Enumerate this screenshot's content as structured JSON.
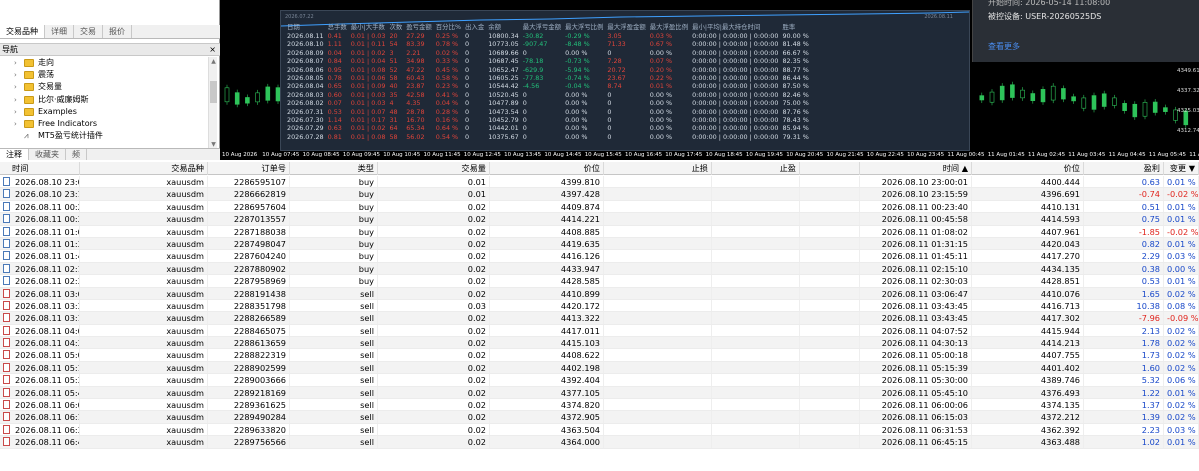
{
  "nav": {
    "tabs": [
      "交易品种",
      "详细",
      "交易",
      "报价"
    ],
    "active_tab": "交易品种",
    "title": "导航",
    "close_glyph": "×",
    "tree": [
      {
        "label": "走向",
        "type": "folder"
      },
      {
        "label": "震荡",
        "type": "folder"
      },
      {
        "label": "交易量",
        "type": "folder"
      },
      {
        "label": "比尔·威廉姆斯",
        "type": "folder"
      },
      {
        "label": "Examples",
        "type": "folder"
      },
      {
        "label": "Free Indicators",
        "type": "folder"
      },
      {
        "label": "MT5盈亏统计插件",
        "type": "script"
      }
    ],
    "bottom_tabs": [
      "注释",
      "收藏夹",
      "频"
    ]
  },
  "popup": {
    "line1": "开始时间: 2026-05-14 11:08:00",
    "line2_label": "被控设备:",
    "line2_value": "USER-20260525DS",
    "link": "查看更多"
  },
  "stats": {
    "mini_date_left": "2026.07.22",
    "mini_date_right": "2026.08.11",
    "headers": [
      "日期",
      "总手数",
      "最小|大手数",
      "次数",
      "盈亏金额",
      "百分比%",
      "出入金",
      "余额",
      "最大浮亏金额",
      "最大浮亏比例",
      "最大浮盈金额",
      "最大浮盈比例",
      "最小|平均|最大持仓时间",
      "胜率"
    ],
    "rows": [
      [
        "2026.08.11",
        "0.41",
        "0.01 | 0.03",
        "20",
        "27.29",
        "0.25 %",
        "0",
        "10800.34",
        "-30.82",
        "-0.29 %",
        "3.05",
        "0.03 %",
        "0:00:00 | 0:00:00 | 0:00:00",
        "90.00 %"
      ],
      [
        "2026.08.10",
        "1.11",
        "0.01 | 0.11",
        "54",
        "83.39",
        "0.78 %",
        "0",
        "10773.05",
        "-907.47",
        "-8.48 %",
        "71.33",
        "0.67 %",
        "0:00:00 | 0:00:00 | 0:00:00",
        "81.48 %"
      ],
      [
        "2026.08.09",
        "0.04",
        "0.01 | 0.02",
        "3",
        "2.21",
        "0.02 %",
        "0",
        "10689.66",
        "0",
        "0.00 %",
        "0",
        "0.00 %",
        "0:00:00 | 0:00:00 | 0:00:00",
        "66.67 %"
      ],
      [
        "2026.08.07",
        "0.84",
        "0.01 | 0.04",
        "51",
        "34.98",
        "0.33 %",
        "0",
        "10687.45",
        "-78.18",
        "-0.73 %",
        "7.28",
        "0.07 %",
        "0:00:00 | 0:00:00 | 0:00:00",
        "82.35 %"
      ],
      [
        "2026.08.06",
        "0.95",
        "0.01 | 0.08",
        "52",
        "47.22",
        "0.45 %",
        "0",
        "10652.47",
        "-629.9",
        "-5.94 %",
        "20.72",
        "0.20 %",
        "0:00:00 | 0:00:00 | 0:00:00",
        "88.77 %"
      ],
      [
        "2026.08.05",
        "0.78",
        "0.01 | 0.06",
        "58",
        "60.43",
        "0.58 %",
        "0",
        "10605.25",
        "-77.83",
        "-0.74 %",
        "23.67",
        "0.22 %",
        "0:00:00 | 0:00:00 | 0:00:00",
        "86.44 %"
      ],
      [
        "2026.08.04",
        "0.65",
        "0.01 | 0.09",
        "40",
        "23.87",
        "0.23 %",
        "0",
        "10544.42",
        "-4.56",
        "-0.04 %",
        "8.74",
        "0.01 %",
        "0:00:00 | 0:00:00 | 0:00:00",
        "87.50 %"
      ],
      [
        "2026.08.03",
        "0.60",
        "0.01 | 0.03",
        "35",
        "42.58",
        "0.41 %",
        "0",
        "10520.45",
        "0",
        "0.00 %",
        "0",
        "0.00 %",
        "0:00:00 | 0:00:00 | 0:00:00",
        "82.46 %"
      ],
      [
        "2026.08.02",
        "0.07",
        "0.01 | 0.03",
        "4",
        "4.35",
        "0.04 %",
        "0",
        "10477.89",
        "0",
        "0.00 %",
        "0",
        "0.00 %",
        "0:00:00 | 0:00:00 | 0:00:00",
        "75.00 %"
      ],
      [
        "2026.07.31",
        "0.53",
        "0.01 | 0.07",
        "48",
        "28.78",
        "0.28 %",
        "0",
        "10473.54",
        "0",
        "0.00 %",
        "0",
        "0.00 %",
        "0:00:00 | 0:00:00 | 0:00:00",
        "87.76 %"
      ],
      [
        "2026.07.30",
        "1.14",
        "0.01 | 0.17",
        "31",
        "16.70",
        "0.16 %",
        "0",
        "10452.79",
        "0",
        "0.00 %",
        "0",
        "0.00 %",
        "0:00:00 | 0:00:00 | 0:00:00",
        "78.43 %"
      ],
      [
        "2026.07.29",
        "0.63",
        "0.01 | 0.02",
        "64",
        "65.34",
        "0.64 %",
        "0",
        "10442.01",
        "0",
        "0.00 %",
        "0",
        "0.00 %",
        "0:00:00 | 0:00:00 | 0:00:00",
        "85.94 %"
      ],
      [
        "2026.07.28",
        "0.81",
        "0.01 | 0.08",
        "58",
        "56.02",
        "0.54 %",
        "0",
        "10375.67",
        "0",
        "0.00 %",
        "0",
        "0.00 %",
        "0:00:00 | 0:00:00 | 0:00:00",
        "79.31 %"
      ]
    ]
  },
  "price_axis": [
    "4349.610",
    "4337.320",
    "4325.030",
    "4312.740"
  ],
  "time_axis": [
    "10 Aug 2026",
    "10 Aug 07:45",
    "10 Aug 08:45",
    "10 Aug 09:45",
    "10 Aug 10:45",
    "10 Aug 11:45",
    "10 Aug 12:45",
    "10 Aug 13:45",
    "10 Aug 14:45",
    "10 Aug 15:45",
    "10 Aug 16:45",
    "10 Aug 17:45",
    "10 Aug 18:45",
    "10 Aug 19:45",
    "10 Aug 20:45",
    "10 Aug 21:45",
    "10 Aug 22:45",
    "10 Aug 23:45",
    "11 Aug 00:45",
    "11 Aug 01:45",
    "11 Aug 02:45",
    "11 Aug 03:45",
    "11 Aug 04:45",
    "11 Aug 05:45",
    "11 Aug 06:45"
  ],
  "colors": {
    "buy": "#4b79b8",
    "sell": "#c94a4a",
    "positive": "#1747c9",
    "negative": "#e0241d",
    "chart_bg": "#000000",
    "candle": "#2ec45a"
  },
  "trades": {
    "headers": [
      "时间",
      "交易品种",
      "订单号",
      "类型",
      "交易量",
      "价位",
      "止损",
      "止盈",
      "时间 ▲",
      "价位",
      "盈利",
      "变更 ▼"
    ],
    "rows": [
      [
        "2026.08.10 23:00:00",
        "xauusdm",
        "2286595107",
        "buy",
        "0.01",
        "4399.810",
        "",
        "",
        "2026.08.10 23:00:01",
        "4400.444",
        "0.63",
        "0.01 %"
      ],
      [
        "2026.08.10 23:15:00",
        "xauusdm",
        "2286662819",
        "buy",
        "0.01",
        "4397.428",
        "",
        "",
        "2026.08.10 23:15:59",
        "4396.691",
        "-0.74",
        "-0.02 %"
      ],
      [
        "2026.08.11 00:23:21",
        "xauusdm",
        "2286957604",
        "buy",
        "0.02",
        "4409.874",
        "",
        "",
        "2026.08.11 00:23:40",
        "4410.131",
        "0.51",
        "0.01 %"
      ],
      [
        "2026.08.11 00:30:00",
        "xauusdm",
        "2287013557",
        "buy",
        "0.02",
        "4414.221",
        "",
        "",
        "2026.08.11 00:45:58",
        "4414.593",
        "0.75",
        "0.01 %"
      ],
      [
        "2026.08.11 01:00:01",
        "xauusdm",
        "2287188038",
        "buy",
        "0.02",
        "4408.885",
        "",
        "",
        "2026.08.11 01:08:02",
        "4407.961",
        "-1.85",
        "-0.02 %"
      ],
      [
        "2026.08.11 01:30:01",
        "xauusdm",
        "2287498047",
        "buy",
        "0.02",
        "4419.635",
        "",
        "",
        "2026.08.11 01:31:15",
        "4420.043",
        "0.82",
        "0.01 %"
      ],
      [
        "2026.08.11 01:45:01",
        "xauusdm",
        "2287604240",
        "buy",
        "0.02",
        "4416.126",
        "",
        "",
        "2026.08.11 01:45:11",
        "4417.270",
        "2.29",
        "0.03 %"
      ],
      [
        "2026.08.11 02:15:00",
        "xauusdm",
        "2287880902",
        "buy",
        "0.02",
        "4433.947",
        "",
        "",
        "2026.08.11 02:15:10",
        "4434.135",
        "0.38",
        "0.00 %"
      ],
      [
        "2026.08.11 02:30:00",
        "xauusdm",
        "2287958969",
        "buy",
        "0.02",
        "4428.585",
        "",
        "",
        "2026.08.11 02:30:03",
        "4428.851",
        "0.53",
        "0.01 %"
      ],
      [
        "2026.08.11 03:00:00",
        "xauusdm",
        "2288191438",
        "sell",
        "0.02",
        "4410.899",
        "",
        "",
        "2026.08.11 03:06:47",
        "4410.076",
        "1.65",
        "0.02 %"
      ],
      [
        "2026.08.11 03:30:00",
        "xauusdm",
        "2288351798",
        "sell",
        "0.03",
        "4420.172",
        "",
        "",
        "2026.08.11 03:43:45",
        "4416.713",
        "10.38",
        "0.08 %"
      ],
      [
        "2026.08.11 03:15:00",
        "xauusdm",
        "2288266589",
        "sell",
        "0.02",
        "4413.322",
        "",
        "",
        "2026.08.11 03:43:45",
        "4417.302",
        "-7.96",
        "-0.09 %"
      ],
      [
        "2026.08.11 04:00:00",
        "xauusdm",
        "2288465075",
        "sell",
        "0.02",
        "4417.011",
        "",
        "",
        "2026.08.11 04:07:52",
        "4415.944",
        "2.13",
        "0.02 %"
      ],
      [
        "2026.08.11 04:30:00",
        "xauusdm",
        "2288613659",
        "sell",
        "0.02",
        "4415.103",
        "",
        "",
        "2026.08.11 04:30:13",
        "4414.213",
        "1.78",
        "0.02 %"
      ],
      [
        "2026.08.11 05:00:00",
        "xauusdm",
        "2288822319",
        "sell",
        "0.02",
        "4408.622",
        "",
        "",
        "2026.08.11 05:00:18",
        "4407.755",
        "1.73",
        "0.02 %"
      ],
      [
        "2026.08.11 05:15:00",
        "xauusdm",
        "2288902599",
        "sell",
        "0.02",
        "4402.198",
        "",
        "",
        "2026.08.11 05:15:39",
        "4401.402",
        "1.60",
        "0.02 %"
      ],
      [
        "2026.08.11 05:30:00",
        "xauusdm",
        "2289003666",
        "sell",
        "0.02",
        "4392.404",
        "",
        "",
        "2026.08.11 05:30:00",
        "4389.746",
        "5.32",
        "0.06 %"
      ],
      [
        "2026.08.11 05:45:00",
        "xauusdm",
        "2289218169",
        "sell",
        "0.02",
        "4377.105",
        "",
        "",
        "2026.08.11 05:45:10",
        "4376.493",
        "1.22",
        "0.01 %"
      ],
      [
        "2026.08.11 06:00:00",
        "xauusdm",
        "2289361625",
        "sell",
        "0.02",
        "4374.820",
        "",
        "",
        "2026.08.11 06:00:06",
        "4374.135",
        "1.37",
        "0.02 %"
      ],
      [
        "2026.08.11 06:15:00",
        "xauusdm",
        "2289490284",
        "sell",
        "0.02",
        "4372.905",
        "",
        "",
        "2026.08.11 06:15:03",
        "4372.212",
        "1.39",
        "0.02 %"
      ],
      [
        "2026.08.11 06:30:00",
        "xauusdm",
        "2289633820",
        "sell",
        "0.02",
        "4363.504",
        "",
        "",
        "2026.08.11 06:31:53",
        "4362.392",
        "2.23",
        "0.03 %"
      ],
      [
        "2026.08.11 06:45:00",
        "xauusdm",
        "2289756566",
        "sell",
        "0.02",
        "4364.000",
        "",
        "",
        "2026.08.11 06:45:15",
        "4363.488",
        "1.02",
        "0.01 %"
      ]
    ]
  }
}
